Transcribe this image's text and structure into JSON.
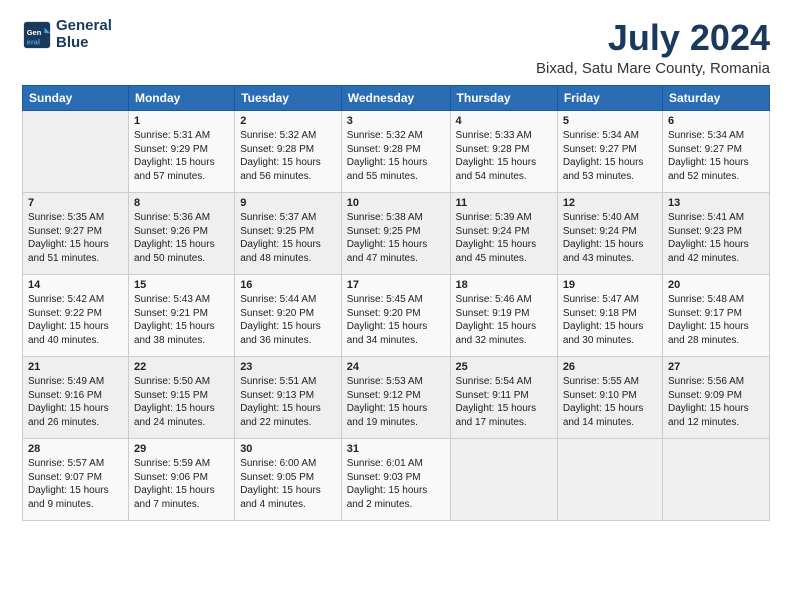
{
  "header": {
    "logo_line1": "General",
    "logo_line2": "Blue",
    "title": "July 2024",
    "subtitle": "Bixad, Satu Mare County, Romania"
  },
  "days_of_week": [
    "Sunday",
    "Monday",
    "Tuesday",
    "Wednesday",
    "Thursday",
    "Friday",
    "Saturday"
  ],
  "weeks": [
    [
      {
        "day": "",
        "content": ""
      },
      {
        "day": "1",
        "content": "Sunrise: 5:31 AM\nSunset: 9:29 PM\nDaylight: 15 hours\nand 57 minutes."
      },
      {
        "day": "2",
        "content": "Sunrise: 5:32 AM\nSunset: 9:28 PM\nDaylight: 15 hours\nand 56 minutes."
      },
      {
        "day": "3",
        "content": "Sunrise: 5:32 AM\nSunset: 9:28 PM\nDaylight: 15 hours\nand 55 minutes."
      },
      {
        "day": "4",
        "content": "Sunrise: 5:33 AM\nSunset: 9:28 PM\nDaylight: 15 hours\nand 54 minutes."
      },
      {
        "day": "5",
        "content": "Sunrise: 5:34 AM\nSunset: 9:27 PM\nDaylight: 15 hours\nand 53 minutes."
      },
      {
        "day": "6",
        "content": "Sunrise: 5:34 AM\nSunset: 9:27 PM\nDaylight: 15 hours\nand 52 minutes."
      }
    ],
    [
      {
        "day": "7",
        "content": "Sunrise: 5:35 AM\nSunset: 9:27 PM\nDaylight: 15 hours\nand 51 minutes."
      },
      {
        "day": "8",
        "content": "Sunrise: 5:36 AM\nSunset: 9:26 PM\nDaylight: 15 hours\nand 50 minutes."
      },
      {
        "day": "9",
        "content": "Sunrise: 5:37 AM\nSunset: 9:25 PM\nDaylight: 15 hours\nand 48 minutes."
      },
      {
        "day": "10",
        "content": "Sunrise: 5:38 AM\nSunset: 9:25 PM\nDaylight: 15 hours\nand 47 minutes."
      },
      {
        "day": "11",
        "content": "Sunrise: 5:39 AM\nSunset: 9:24 PM\nDaylight: 15 hours\nand 45 minutes."
      },
      {
        "day": "12",
        "content": "Sunrise: 5:40 AM\nSunset: 9:24 PM\nDaylight: 15 hours\nand 43 minutes."
      },
      {
        "day": "13",
        "content": "Sunrise: 5:41 AM\nSunset: 9:23 PM\nDaylight: 15 hours\nand 42 minutes."
      }
    ],
    [
      {
        "day": "14",
        "content": "Sunrise: 5:42 AM\nSunset: 9:22 PM\nDaylight: 15 hours\nand 40 minutes."
      },
      {
        "day": "15",
        "content": "Sunrise: 5:43 AM\nSunset: 9:21 PM\nDaylight: 15 hours\nand 38 minutes."
      },
      {
        "day": "16",
        "content": "Sunrise: 5:44 AM\nSunset: 9:20 PM\nDaylight: 15 hours\nand 36 minutes."
      },
      {
        "day": "17",
        "content": "Sunrise: 5:45 AM\nSunset: 9:20 PM\nDaylight: 15 hours\nand 34 minutes."
      },
      {
        "day": "18",
        "content": "Sunrise: 5:46 AM\nSunset: 9:19 PM\nDaylight: 15 hours\nand 32 minutes."
      },
      {
        "day": "19",
        "content": "Sunrise: 5:47 AM\nSunset: 9:18 PM\nDaylight: 15 hours\nand 30 minutes."
      },
      {
        "day": "20",
        "content": "Sunrise: 5:48 AM\nSunset: 9:17 PM\nDaylight: 15 hours\nand 28 minutes."
      }
    ],
    [
      {
        "day": "21",
        "content": "Sunrise: 5:49 AM\nSunset: 9:16 PM\nDaylight: 15 hours\nand 26 minutes."
      },
      {
        "day": "22",
        "content": "Sunrise: 5:50 AM\nSunset: 9:15 PM\nDaylight: 15 hours\nand 24 minutes."
      },
      {
        "day": "23",
        "content": "Sunrise: 5:51 AM\nSunset: 9:13 PM\nDaylight: 15 hours\nand 22 minutes."
      },
      {
        "day": "24",
        "content": "Sunrise: 5:53 AM\nSunset: 9:12 PM\nDaylight: 15 hours\nand 19 minutes."
      },
      {
        "day": "25",
        "content": "Sunrise: 5:54 AM\nSunset: 9:11 PM\nDaylight: 15 hours\nand 17 minutes."
      },
      {
        "day": "26",
        "content": "Sunrise: 5:55 AM\nSunset: 9:10 PM\nDaylight: 15 hours\nand 14 minutes."
      },
      {
        "day": "27",
        "content": "Sunrise: 5:56 AM\nSunset: 9:09 PM\nDaylight: 15 hours\nand 12 minutes."
      }
    ],
    [
      {
        "day": "28",
        "content": "Sunrise: 5:57 AM\nSunset: 9:07 PM\nDaylight: 15 hours\nand 9 minutes."
      },
      {
        "day": "29",
        "content": "Sunrise: 5:59 AM\nSunset: 9:06 PM\nDaylight: 15 hours\nand 7 minutes."
      },
      {
        "day": "30",
        "content": "Sunrise: 6:00 AM\nSunset: 9:05 PM\nDaylight: 15 hours\nand 4 minutes."
      },
      {
        "day": "31",
        "content": "Sunrise: 6:01 AM\nSunset: 9:03 PM\nDaylight: 15 hours\nand 2 minutes."
      },
      {
        "day": "",
        "content": ""
      },
      {
        "day": "",
        "content": ""
      },
      {
        "day": "",
        "content": ""
      }
    ]
  ]
}
